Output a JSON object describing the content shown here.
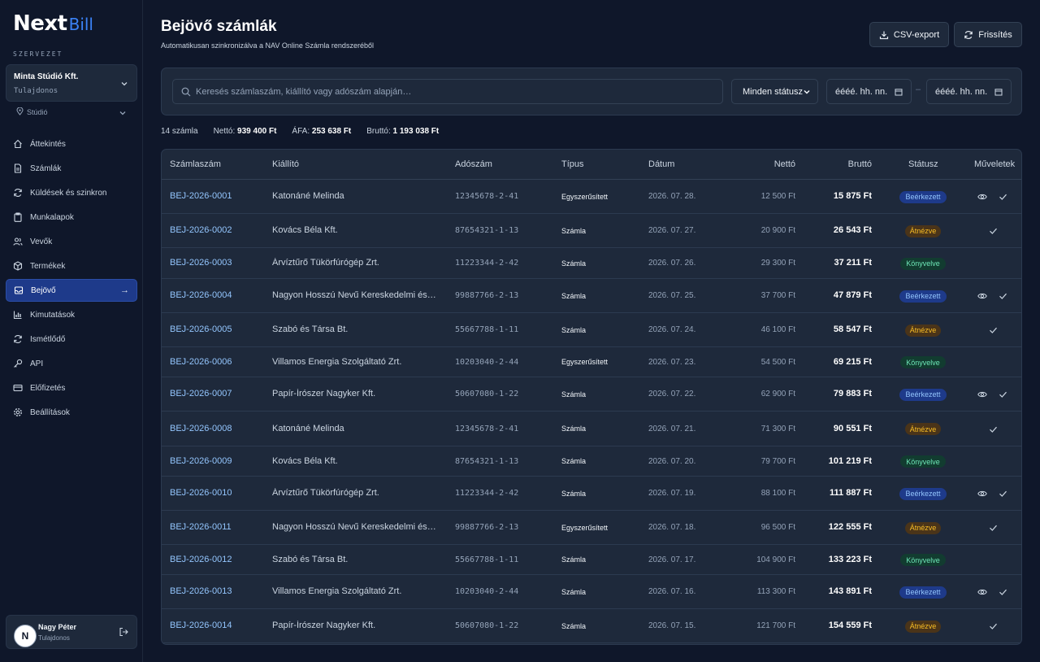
{
  "brand": {
    "next": "Next",
    "bill": "Bill"
  },
  "org": {
    "section_label": "SZERVEZET",
    "name": "Minta Stúdió Kft.",
    "role": "Tulajdonos",
    "studio": "Stúdió"
  },
  "nav": [
    {
      "label": "Áttekintés",
      "icon": "grid-icon"
    },
    {
      "label": "Számlák",
      "icon": "document-icon"
    },
    {
      "label": "Küldések és szinkron",
      "icon": "sync-icon"
    },
    {
      "label": "Munkalapok",
      "icon": "clipboard-icon"
    },
    {
      "label": "Vevők",
      "icon": "users-icon"
    },
    {
      "label": "Termékek",
      "icon": "box-icon"
    },
    {
      "label": "Bejövő",
      "icon": "inbox-icon",
      "active": true
    },
    {
      "label": "Kimutatások",
      "icon": "bar-chart-icon"
    },
    {
      "label": "Ismétlődő",
      "icon": "repeat-icon"
    },
    {
      "label": "API",
      "icon": "key-icon"
    },
    {
      "label": "Előfizetés",
      "icon": "credit-card-icon"
    },
    {
      "label": "Beállítások",
      "icon": "gear-icon"
    }
  ],
  "user": {
    "initial": "N",
    "name": "Nagy Péter",
    "role": "Tulajdonos"
  },
  "page": {
    "title": "Bejövő számlák",
    "subtitle": "Automatikusan szinkronizálva a NAV Online Számla rendszeréből",
    "csv_label": "CSV-export",
    "refresh_label": "Frissítés"
  },
  "filters": {
    "search_placeholder": "Keresés számlaszám, kiállító vagy adószám alapján…",
    "status": "Minden státusz",
    "date_from": "éééé. hh. nn.",
    "date_sep": "–",
    "date_to": "éééé. hh. nn."
  },
  "summary": {
    "count": "14 számla",
    "net_label": "Nettó:",
    "net": "939 400 Ft",
    "vat_label": "ÁFA:",
    "vat": "253 638 Ft",
    "gross_label": "Bruttó:",
    "gross": "1 193 038 Ft"
  },
  "table": {
    "headers": {
      "num": "Számlaszám",
      "issuer": "Kiállító",
      "tax": "Adószám",
      "type": "Típus",
      "date": "Dátum",
      "net": "Nettó",
      "gross": "Bruttó",
      "status": "Státusz",
      "actions": "Műveletek"
    },
    "status_colors": {
      "Beérkezett": "#1e3a8a",
      "Átnézve": "#4a3419",
      "Könyvelve": "#123c30"
    },
    "rows": [
      {
        "num": "BEJ-2026-0001",
        "issuer": "Katonáné Melinda",
        "tax": "12345678-2-41",
        "type": "Egyszerűsített",
        "date": "2026. 07. 28.",
        "net": "12 500 Ft",
        "gross": "15 875 Ft",
        "status": "Beérkezett",
        "actions": [
          "view",
          "check"
        ]
      },
      {
        "num": "BEJ-2026-0002",
        "issuer": "Kovács Béla Kft.",
        "tax": "87654321-1-13",
        "type": "Számla",
        "date": "2026. 07. 27.",
        "net": "20 900 Ft",
        "gross": "26 543 Ft",
        "status": "Átnézve",
        "actions": [
          "check"
        ]
      },
      {
        "num": "BEJ-2026-0003",
        "issuer": "Árvíztűrő Tükörfúrógép Zrt.",
        "tax": "11223344-2-42",
        "type": "Számla",
        "date": "2026. 07. 26.",
        "net": "29 300 Ft",
        "gross": "37 211 Ft",
        "status": "Könyvelve",
        "actions": []
      },
      {
        "num": "BEJ-2026-0004",
        "issuer": "Nagyon Hosszú Nevű Kereskedelmi és Szolgáltató Kft.",
        "tax": "99887766-2-13",
        "type": "Számla",
        "date": "2026. 07. 25.",
        "net": "37 700 Ft",
        "gross": "47 879 Ft",
        "status": "Beérkezett",
        "actions": [
          "view",
          "check"
        ]
      },
      {
        "num": "BEJ-2026-0005",
        "issuer": "Szabó és Társa Bt.",
        "tax": "55667788-1-11",
        "type": "Számla",
        "date": "2026. 07. 24.",
        "net": "46 100 Ft",
        "gross": "58 547 Ft",
        "status": "Átnézve",
        "actions": [
          "check"
        ]
      },
      {
        "num": "BEJ-2026-0006",
        "issuer": "Villamos Energia Szolgáltató Zrt.",
        "tax": "10203040-2-44",
        "type": "Egyszerűsített",
        "date": "2026. 07. 23.",
        "net": "54 500 Ft",
        "gross": "69 215 Ft",
        "status": "Könyvelve",
        "actions": []
      },
      {
        "num": "BEJ-2026-0007",
        "issuer": "Papír-Írószer Nagyker Kft.",
        "tax": "50607080-1-22",
        "type": "Számla",
        "date": "2026. 07. 22.",
        "net": "62 900 Ft",
        "gross": "79 883 Ft",
        "status": "Beérkezett",
        "actions": [
          "view",
          "check"
        ]
      },
      {
        "num": "BEJ-2026-0008",
        "issuer": "Katonáné Melinda",
        "tax": "12345678-2-41",
        "type": "Számla",
        "date": "2026. 07. 21.",
        "net": "71 300 Ft",
        "gross": "90 551 Ft",
        "status": "Átnézve",
        "actions": [
          "check"
        ]
      },
      {
        "num": "BEJ-2026-0009",
        "issuer": "Kovács Béla Kft.",
        "tax": "87654321-1-13",
        "type": "Számla",
        "date": "2026. 07. 20.",
        "net": "79 700 Ft",
        "gross": "101 219 Ft",
        "status": "Könyvelve",
        "actions": []
      },
      {
        "num": "BEJ-2026-0010",
        "issuer": "Árvíztűrő Tükörfúrógép Zrt.",
        "tax": "11223344-2-42",
        "type": "Számla",
        "date": "2026. 07. 19.",
        "net": "88 100 Ft",
        "gross": "111 887 Ft",
        "status": "Beérkezett",
        "actions": [
          "view",
          "check"
        ]
      },
      {
        "num": "BEJ-2026-0011",
        "issuer": "Nagyon Hosszú Nevű Kereskedelmi és Szolgáltató Kft.",
        "tax": "99887766-2-13",
        "type": "Egyszerűsített",
        "date": "2026. 07. 18.",
        "net": "96 500 Ft",
        "gross": "122 555 Ft",
        "status": "Átnézve",
        "actions": [
          "check"
        ]
      },
      {
        "num": "BEJ-2026-0012",
        "issuer": "Szabó és Társa Bt.",
        "tax": "55667788-1-11",
        "type": "Számla",
        "date": "2026. 07. 17.",
        "net": "104 900 Ft",
        "gross": "133 223 Ft",
        "status": "Könyvelve",
        "actions": []
      },
      {
        "num": "BEJ-2026-0013",
        "issuer": "Villamos Energia Szolgáltató Zrt.",
        "tax": "10203040-2-44",
        "type": "Számla",
        "date": "2026. 07. 16.",
        "net": "113 300 Ft",
        "gross": "143 891 Ft",
        "status": "Beérkezett",
        "actions": [
          "view",
          "check"
        ]
      },
      {
        "num": "BEJ-2026-0014",
        "issuer": "Papír-Írószer Nagyker Kft.",
        "tax": "50607080-1-22",
        "type": "Számla",
        "date": "2026. 07. 15.",
        "net": "121 700 Ft",
        "gross": "154 559 Ft",
        "status": "Átnézve",
        "actions": [
          "check"
        ]
      }
    ]
  }
}
